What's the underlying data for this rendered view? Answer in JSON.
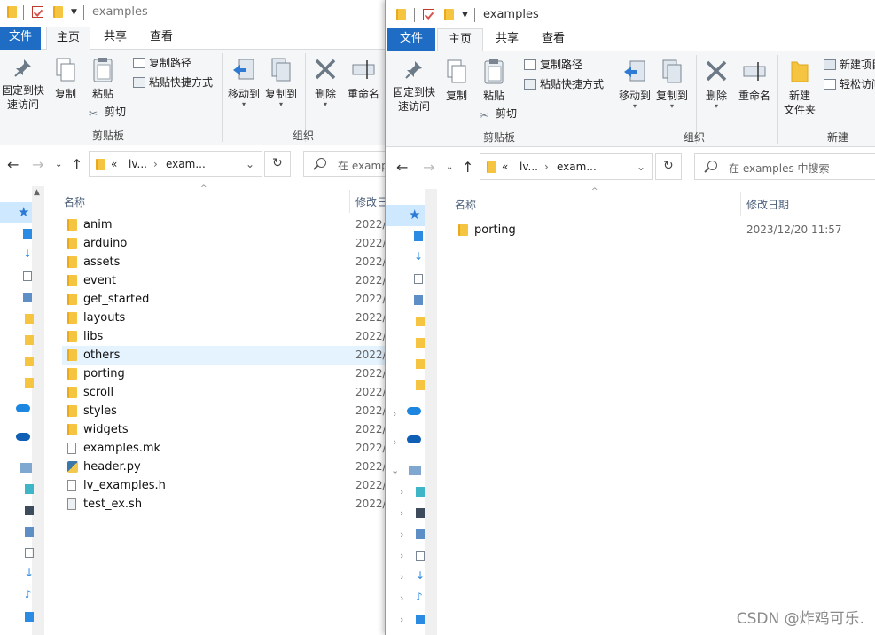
{
  "left": {
    "title": "examples",
    "tabs": [
      "文件",
      "主页",
      "共享",
      "查看"
    ],
    "ribbon": {
      "pin": "固定到快\n速访问",
      "copy": "复制",
      "paste": "粘贴",
      "copy_path": "复制路径",
      "paste_shortcut": "粘贴快捷方式",
      "cut": "剪切",
      "clipboard": "剪贴板",
      "move_to": "移动到",
      "copy_to": "复制到",
      "delete": "删除",
      "rename": "重命名",
      "organize": "组织"
    },
    "address": {
      "root": "«",
      "seg1": "lv...",
      "seg2": "exam..."
    },
    "search_placeholder": "在 examp",
    "headers": {
      "name": "名称",
      "date": "修改日"
    },
    "files": [
      {
        "name": "anim",
        "kind": "folder",
        "date": "2022/"
      },
      {
        "name": "arduino",
        "kind": "folder",
        "date": "2022/"
      },
      {
        "name": "assets",
        "kind": "folder",
        "date": "2022/"
      },
      {
        "name": "event",
        "kind": "folder",
        "date": "2022/"
      },
      {
        "name": "get_started",
        "kind": "folder",
        "date": "2022/"
      },
      {
        "name": "layouts",
        "kind": "folder",
        "date": "2022/"
      },
      {
        "name": "libs",
        "kind": "folder",
        "date": "2022/"
      },
      {
        "name": "others",
        "kind": "folder",
        "date": "2022/"
      },
      {
        "name": "porting",
        "kind": "folder",
        "date": "2022/"
      },
      {
        "name": "scroll",
        "kind": "folder",
        "date": "2022/"
      },
      {
        "name": "styles",
        "kind": "folder",
        "date": "2022/"
      },
      {
        "name": "widgets",
        "kind": "folder",
        "date": "2022/"
      },
      {
        "name": "examples.mk",
        "kind": "file",
        "date": "2022/"
      },
      {
        "name": "header.py",
        "kind": "python",
        "date": "2022/"
      },
      {
        "name": "lv_examples.h",
        "kind": "file",
        "date": "2022/"
      },
      {
        "name": "test_ex.sh",
        "kind": "script",
        "date": "2022/"
      }
    ]
  },
  "right": {
    "title": "examples",
    "tabs": [
      "文件",
      "主页",
      "共享",
      "查看"
    ],
    "ribbon": {
      "pin": "固定到快\n速访问",
      "copy": "复制",
      "paste": "粘贴",
      "copy_path": "复制路径",
      "paste_shortcut": "粘贴快捷方式",
      "cut": "剪切",
      "clipboard": "剪贴板",
      "move_to": "移动到",
      "copy_to": "复制到",
      "delete": "删除",
      "rename": "重命名",
      "organize": "组织",
      "new_folder": "新建\n文件夹",
      "new_item": "新建项目",
      "easy_access": "轻松访问",
      "new_group": "新建"
    },
    "address": {
      "root": "«",
      "seg1": "lv...",
      "seg2": "exam..."
    },
    "search_placeholder": "在 examples 中搜索",
    "headers": {
      "name": "名称",
      "date": "修改日期"
    },
    "files": [
      {
        "name": "porting",
        "kind": "folder",
        "date": "2023/12/20 11:57"
      }
    ]
  },
  "watermark": "CSDN @炸鸡可乐.",
  "colors": {
    "accent": "#1e6cc4",
    "folder": "#f5c542",
    "hover": "#e5f3ff",
    "nav_selected": "#cde8ff"
  }
}
